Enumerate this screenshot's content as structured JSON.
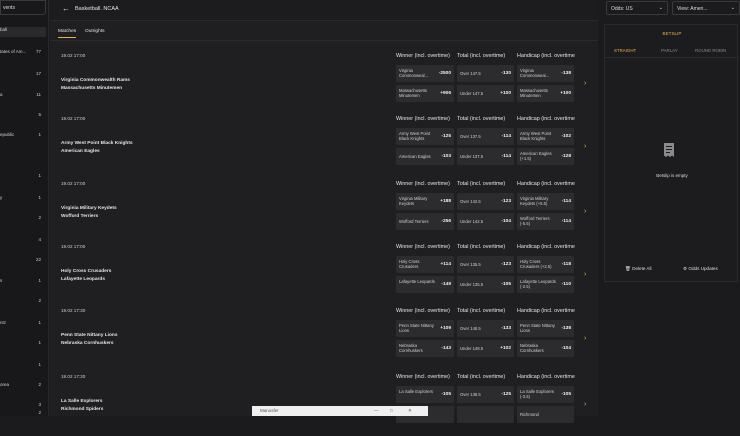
{
  "sidebar": {
    "top_label": "vents",
    "items": [
      {
        "label": "ball",
        "count": ""
      },
      {
        "label": "tates of Am...",
        "count": "77"
      },
      {
        "label": "",
        "count": "17"
      },
      {
        "label": "a",
        "count": "11"
      },
      {
        "label": "",
        "count": "5"
      },
      {
        "label": "epublic",
        "count": "1"
      },
      {
        "label": "",
        "count": "1"
      },
      {
        "label": "y",
        "count": "1"
      },
      {
        "label": "",
        "count": "2"
      },
      {
        "label": "",
        "count": "4"
      },
      {
        "label": "",
        "count": "22"
      },
      {
        "label": "s",
        "count": "1"
      },
      {
        "label": "",
        "count": "2"
      },
      {
        "label": "ntz",
        "count": "1"
      },
      {
        "label": "",
        "count": "1"
      },
      {
        "label": "",
        "count": "1"
      },
      {
        "label": "orea",
        "count": "2"
      },
      {
        "label": "",
        "count": "3"
      },
      {
        "label": "",
        "count": "2"
      }
    ]
  },
  "header": {
    "back_icon": "arrow-left-icon",
    "title": "Basketball. NCAA"
  },
  "tabs": [
    {
      "label": "Matches"
    },
    {
      "label": "Outrights"
    }
  ],
  "columns": {
    "winner": "Winner (incl. overtime)",
    "total": "Total (incl. overtime)",
    "handicap": "Handicap (incl. overtime)"
  },
  "events": [
    {
      "time": "19.02   17:00",
      "home": "Virginia Commonwealth Rams",
      "away": "Massachusetts Minutemen",
      "winner": [
        {
          "label": "Virginia Commonweal...",
          "odds": "-2500"
        },
        {
          "label": "Massachusetts Minutemen",
          "odds": "+906"
        }
      ],
      "total": [
        {
          "label": "Over 147.5",
          "odds": "-130"
        },
        {
          "label": "Under 147.5",
          "odds": "+100"
        }
      ],
      "handicap": [
        {
          "label": "Virginia Commonweal...",
          "odds": "-138"
        },
        {
          "label": "Massachusetts Minutemen",
          "odds": "+100"
        }
      ]
    },
    {
      "time": "19.02   17:00",
      "home": "Army West Point Black Knights",
      "away": "American Eagles",
      "winner": [
        {
          "label": "Army West Point Black Knights",
          "odds": "-125"
        },
        {
          "label": "American Eagles",
          "odds": "-103"
        }
      ],
      "total": [
        {
          "label": "Over 137.5",
          "odds": "-114"
        },
        {
          "label": "Under 137.5",
          "odds": "-114"
        }
      ],
      "handicap": [
        {
          "label": "Army West Point Black Knights",
          "odds": "-102"
        },
        {
          "label": "American Eagles (+1.5)",
          "odds": "-128"
        }
      ]
    },
    {
      "time": "19.02   17:00",
      "home": "Virginia Military Keydets",
      "away": "Wofford Terriers",
      "winner": [
        {
          "label": "Virginia Military Keydets",
          "odds": "+188"
        },
        {
          "label": "Wofford Terriers",
          "odds": "-256"
        }
      ],
      "total": [
        {
          "label": "Over 142.5",
          "odds": "-123"
        },
        {
          "label": "Under 142.5",
          "odds": "-104"
        }
      ],
      "handicap": [
        {
          "label": "Virginia Military Keydets (+5.5)",
          "odds": "-114"
        },
        {
          "label": "Wofford Terriers (-5.5)",
          "odds": "-114"
        }
      ]
    },
    {
      "time": "19.02   17:00",
      "home": "Holy Cross Crusaders",
      "away": "Lafayette Leopards",
      "winner": [
        {
          "label": "Holy Cross Crusaders",
          "odds": "+114"
        },
        {
          "label": "Lafayette Leopards",
          "odds": "-149"
        }
      ],
      "total": [
        {
          "label": "Over 135.5",
          "odds": "-123"
        },
        {
          "label": "Under 135.5",
          "odds": "-105"
        }
      ],
      "handicap": [
        {
          "label": "Holy Cross Crusaders (+2.5)",
          "odds": "-118"
        },
        {
          "label": "Lafayette Leopards (-2.5)",
          "odds": "-110"
        }
      ]
    },
    {
      "time": "19.02   17:30",
      "home": "Penn State Nittany Lions",
      "away": "Nebraska Cornhuskers",
      "winner": [
        {
          "label": "Penn State Nittany Lions",
          "odds": "+109"
        },
        {
          "label": "Nebraska Cornhuskers",
          "odds": "-143"
        }
      ],
      "total": [
        {
          "label": "Over 148.5",
          "odds": "-133"
        },
        {
          "label": "Under 148.5",
          "odds": "+102"
        }
      ],
      "handicap": [
        {
          "label": "Penn State Nittany Lions",
          "odds": "-138"
        },
        {
          "label": "Nebraska Cornhuskers",
          "odds": "-104"
        }
      ]
    },
    {
      "time": "19.02   17:30",
      "home": "La Salle Explorers",
      "away": "Richmond Spiders",
      "winner": [
        {
          "label": "La Salle Explorers",
          "odds": "-105"
        },
        {
          "label": "",
          "odds": ""
        }
      ],
      "total": [
        {
          "label": "Over 138.5",
          "odds": "-125"
        },
        {
          "label": "",
          "odds": ""
        }
      ],
      "handicap": [
        {
          "label": "La Salle Explorers (-3.5)",
          "odds": "-105"
        },
        {
          "label": "Richmond",
          "odds": ""
        }
      ]
    }
  ],
  "odds_select": {
    "label": "Odds:",
    "value": "US"
  },
  "view_select": {
    "label": "View:",
    "value": "Ameri..."
  },
  "betslip": {
    "title": "BETSLIP",
    "tabs": [
      {
        "label": "STRAIGHT"
      },
      {
        "label": "PARLAY"
      },
      {
        "label": "ROUND ROBIN"
      }
    ],
    "empty_text": "Betslip is empty",
    "delete_all": "Delete All",
    "odds_updates": "Odds Updates"
  },
  "taskbar": {
    "label": "Manosfer"
  },
  "colors": {
    "accent": "#e8b14a",
    "background": "#1f1f21",
    "cell": "#2c2c2e"
  }
}
